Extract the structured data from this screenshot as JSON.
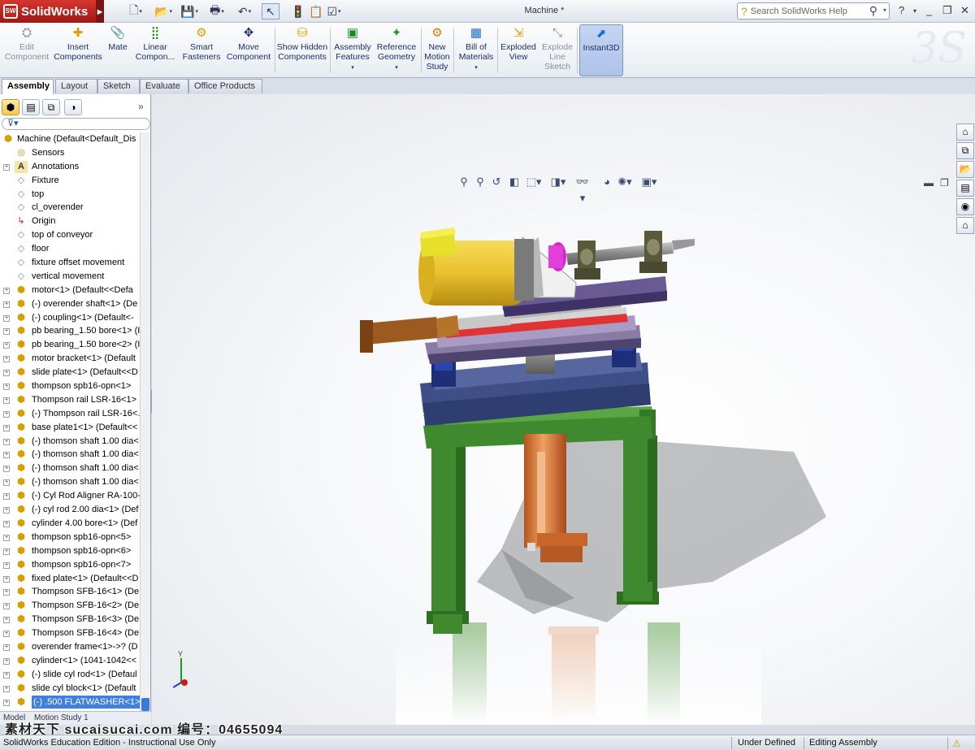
{
  "app": {
    "name": "SolidWorks",
    "logo_mark": "SW"
  },
  "quick_access": [
    "new-icon",
    "open-icon",
    "save-icon",
    "print-icon",
    "undo-icon",
    "select-icon",
    "rebuild-icon",
    "file-properties-icon",
    "options-icon"
  ],
  "document_title": "Machine *",
  "help_search": {
    "placeholder": "Search SolidWorks Help"
  },
  "window_buttons": {
    "minimize": "_",
    "restore": "❐",
    "close": "✕",
    "help": "?"
  },
  "commands": [
    {
      "label": "Edit Component",
      "icon": "edit-component-icon",
      "disabled": true
    },
    {
      "label": "Insert Components",
      "icon": "insert-components-icon"
    },
    {
      "label": "Mate",
      "icon": "mate-icon"
    },
    {
      "label": "Linear Compon...",
      "icon": "linear-pattern-icon"
    },
    {
      "label": "Smart Fasteners",
      "icon": "smart-fasteners-icon"
    },
    {
      "label": "Move Component",
      "icon": "move-component-icon"
    },
    {
      "label": "Show Hidden Components",
      "icon": "show-hidden-icon"
    },
    {
      "label": "Assembly Features",
      "icon": "assembly-features-icon"
    },
    {
      "label": "Reference Geometry",
      "icon": "reference-geometry-icon"
    },
    {
      "label": "New Motion Study",
      "icon": "motion-study-icon"
    },
    {
      "label": "Bill of Materials",
      "icon": "bom-icon"
    },
    {
      "label": "Exploded View",
      "icon": "exploded-view-icon"
    },
    {
      "label": "Explode Line Sketch",
      "icon": "explode-line-icon",
      "disabled": true
    },
    {
      "label": "Instant3D",
      "icon": "instant3d-icon",
      "active": true
    }
  ],
  "tabs": [
    "Assembly",
    "Layout",
    "Sketch",
    "Evaluate",
    "Office Products"
  ],
  "active_tab": "Assembly",
  "feature_tree": {
    "root": "Machine  (Default<Default_Dis",
    "items": [
      {
        "label": "Sensors",
        "icon": "sensors-icon",
        "expand": false
      },
      {
        "label": "Annotations",
        "icon": "annotations-icon",
        "expand": true
      },
      {
        "label": "Fixture",
        "icon": "plane-icon",
        "expand": false
      },
      {
        "label": "top",
        "icon": "plane-icon",
        "expand": false
      },
      {
        "label": "cl_overender",
        "icon": "plane-icon",
        "expand": false
      },
      {
        "label": "Origin",
        "icon": "origin-icon",
        "expand": false
      },
      {
        "label": "top of conveyor",
        "icon": "plane-icon",
        "expand": false
      },
      {
        "label": "floor",
        "icon": "plane-icon",
        "expand": false
      },
      {
        "label": "fixture offset movement",
        "icon": "plane-icon",
        "expand": false
      },
      {
        "label": "vertical movement",
        "icon": "plane-icon",
        "expand": false
      },
      {
        "label": "motor<1> (Default<<Defa",
        "icon": "part-icon",
        "expand": true
      },
      {
        "label": "(-) overender shaft<1> (De",
        "icon": "part-icon",
        "expand": true
      },
      {
        "label": "(-) coupling<1> (Default<-",
        "icon": "part-icon",
        "expand": true
      },
      {
        "label": "pb bearing_1.50 bore<1> (I",
        "icon": "part-icon",
        "expand": true
      },
      {
        "label": "pb bearing_1.50 bore<2> (I",
        "icon": "part-icon",
        "expand": true
      },
      {
        "label": "motor bracket<1> (Default",
        "icon": "part-icon",
        "expand": true
      },
      {
        "label": "slide plate<1> (Default<<D",
        "icon": "part-icon",
        "expand": true
      },
      {
        "label": "thompson spb16-opn<1>",
        "icon": "part-icon",
        "expand": true
      },
      {
        "label": "Thompson rail LSR-16<1>",
        "icon": "part-icon",
        "expand": true
      },
      {
        "label": "(-) Thompson rail LSR-16<.",
        "icon": "part-icon",
        "expand": true
      },
      {
        "label": "base plate1<1> (Default<<",
        "icon": "part-icon",
        "expand": true
      },
      {
        "label": "(-) thomson shaft 1.00 dia<",
        "icon": "part-icon",
        "expand": true
      },
      {
        "label": "(-) thomson shaft 1.00 dia<",
        "icon": "part-icon",
        "expand": true
      },
      {
        "label": "(-) thomson shaft 1.00 dia<",
        "icon": "part-icon",
        "expand": true
      },
      {
        "label": "(-) thomson shaft 1.00 dia<",
        "icon": "part-icon",
        "expand": true
      },
      {
        "label": "(-) Cyl Rod Aligner RA-100-",
        "icon": "part-icon",
        "expand": true
      },
      {
        "label": "(-) cyl rod 2.00 dia<1> (Def",
        "icon": "part-icon",
        "expand": true
      },
      {
        "label": "cylinder 4.00 bore<1> (Def",
        "icon": "part-icon",
        "expand": true
      },
      {
        "label": "thompson spb16-opn<5>",
        "icon": "part-icon",
        "expand": true
      },
      {
        "label": "thompson spb16-opn<6>",
        "icon": "part-icon",
        "expand": true
      },
      {
        "label": "thompson spb16-opn<7>",
        "icon": "part-icon",
        "expand": true
      },
      {
        "label": "fixed plate<1> (Default<<D",
        "icon": "part-icon",
        "expand": true
      },
      {
        "label": "Thompson SFB-16<1> (De",
        "icon": "part-icon",
        "expand": true
      },
      {
        "label": "Thompson SFB-16<2> (De",
        "icon": "part-icon",
        "expand": true
      },
      {
        "label": "Thompson SFB-16<3> (De",
        "icon": "part-icon",
        "expand": true
      },
      {
        "label": "Thompson SFB-16<4> (De",
        "icon": "part-icon",
        "expand": true
      },
      {
        "label": "overender frame<1>->? (D",
        "icon": "part-icon",
        "expand": true
      },
      {
        "label": "cylinder<1> (1041-1042<<",
        "icon": "part-icon",
        "expand": true
      },
      {
        "label": "(-) slide cyl rod<1> (Defaul",
        "icon": "part-icon",
        "expand": true
      },
      {
        "label": "slide cyl block<1> (Default",
        "icon": "part-icon",
        "expand": true
      },
      {
        "label": "(-) .500 FLATWASHER<1>",
        "icon": "part-icon",
        "expand": true,
        "selected": true
      }
    ]
  },
  "fm_bottom_tabs": [
    "Model",
    "Motion Study 1"
  ],
  "heads_up_toolbar": [
    "zoom-to-fit-icon",
    "zoom-area-icon",
    "previous-view-icon",
    "section-view-icon",
    "view-orientation-icon",
    "display-style-icon",
    "hide-show-icon",
    "edit-appearance-icon",
    "apply-scene-icon",
    "view-settings-icon"
  ],
  "task_pane": [
    "home-icon",
    "design-library-icon",
    "file-explorer-icon",
    "view-palette-icon",
    "appearances-icon",
    "custom-properties-icon"
  ],
  "triad": {
    "x": "",
    "y": "Y",
    "z": ""
  },
  "status": {
    "edition": "SolidWorks Education Edition - Instructional Use Only",
    "definition": "Under Defined",
    "mode": "Editing Assembly"
  },
  "watermark": "素材天下 sucaisucai.com  编号：04655094",
  "colors": {
    "frame_green": "#3f8a2e",
    "motor_yellow": "#e8c12e",
    "cylinder_orange": "#d8772e",
    "slide_red": "#e03434",
    "plate_blue": "#3e4f88"
  }
}
